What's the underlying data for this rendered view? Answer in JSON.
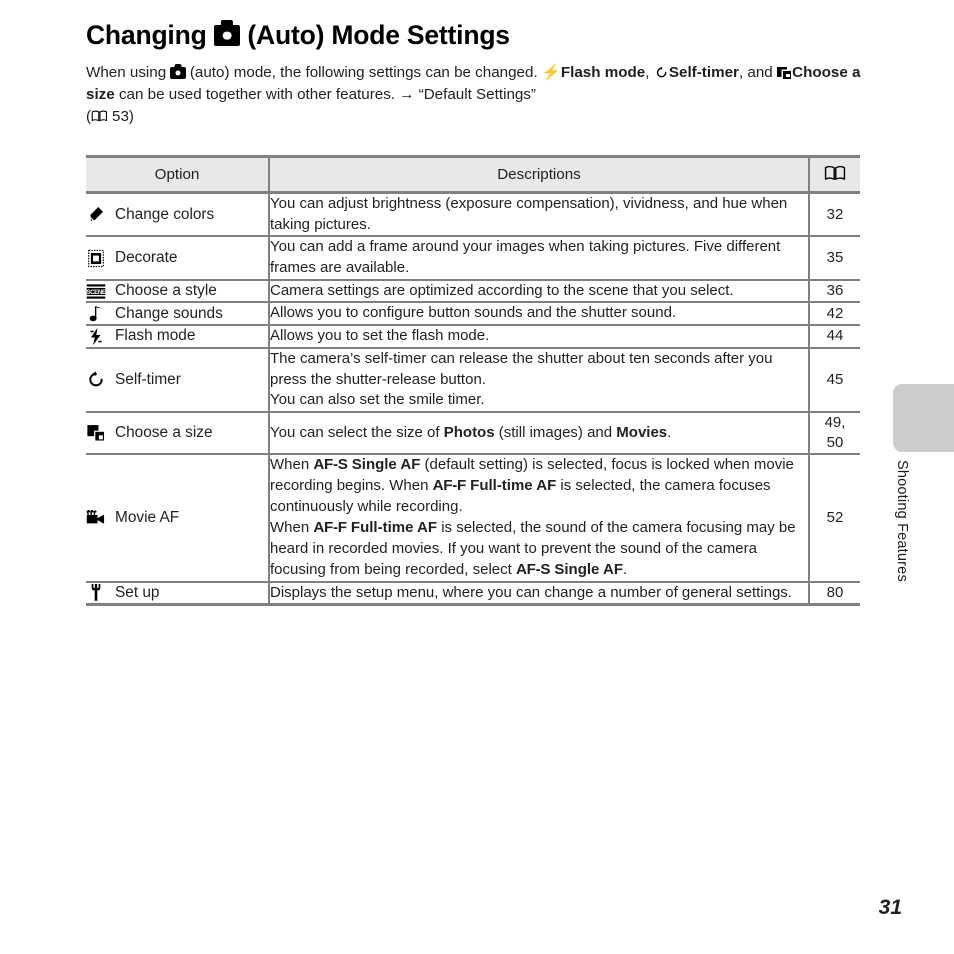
{
  "document": {
    "title_prefix": "Changing ",
    "title_suffix": " (Auto) Mode Settings",
    "title_icon": "camera-auto-icon",
    "page_number": "31",
    "side_tab_label": "Shooting Features"
  },
  "intro": {
    "seg1": "When using ",
    "icon1": "camera-auto-icon",
    "seg2": " (auto) mode, the following settings can be changed. ",
    "icon2": "flash-icon",
    "bold1": "Flash mode",
    "seg3": ", ",
    "icon3": "self-timer-icon",
    "bold2": "Self-timer",
    "seg4": ", and ",
    "icon4": "choose-a-size-icon",
    "bold3": "Choose a size",
    "seg5": " can be used together with other features. ",
    "arrow": "→",
    "seg6": " “Default Settings”",
    "ref_open": "(",
    "ref_icon": "book-icon",
    "ref_page": "53",
    "ref_close": ")"
  },
  "table": {
    "headers": {
      "option": "Option",
      "descriptions": "Descriptions",
      "reference": "book-icon"
    },
    "rows": [
      {
        "icon": "change-colors-icon",
        "option": "Change colors",
        "description_parts": [
          {
            "t": "You can adjust brightness (exposure compensation), vividness, and hue when taking pictures.",
            "b": false
          }
        ],
        "reference": "32"
      },
      {
        "icon": "decorate-icon",
        "option": "Decorate",
        "description_parts": [
          {
            "t": "You can add a frame around your images when taking pictures. Five different frames are available.",
            "b": false
          }
        ],
        "reference": "35"
      },
      {
        "icon": "choose-a-style-icon",
        "option": "Choose a style",
        "description_parts": [
          {
            "t": "Camera settings are optimized according to the scene that you select.",
            "b": false
          }
        ],
        "reference": "36"
      },
      {
        "icon": "change-sounds-icon",
        "option": "Change sounds",
        "description_parts": [
          {
            "t": "Allows you to configure button sounds and the shutter sound.",
            "b": false
          }
        ],
        "reference": "42"
      },
      {
        "icon": "flash-icon",
        "option": "Flash mode",
        "description_parts": [
          {
            "t": "Allows you to set the flash mode.",
            "b": false
          }
        ],
        "reference": "44"
      },
      {
        "icon": "self-timer-icon",
        "option": "Self-timer",
        "description_parts": [
          {
            "t": "The camera’s self-timer can release the shutter about ten seconds after you press the shutter-release button.",
            "b": false
          },
          {
            "t": "\n",
            "b": false
          },
          {
            "t": "You can also set the smile timer.",
            "b": false
          }
        ],
        "reference": "45"
      },
      {
        "icon": "choose-a-size-icon",
        "option": "Choose a size",
        "description_parts": [
          {
            "t": "You can select the size of ",
            "b": false
          },
          {
            "t": "Photos",
            "b": true
          },
          {
            "t": " (still images) and ",
            "b": false
          },
          {
            "t": "Movies",
            "b": true
          },
          {
            "t": ".",
            "b": false
          }
        ],
        "reference": "49,\n50"
      },
      {
        "icon": "movie-af-icon",
        "option": "Movie AF",
        "description_parts": [
          {
            "t": "When ",
            "b": false
          },
          {
            "t": "AF-S Single AF",
            "b": true
          },
          {
            "t": " (default setting) is selected, focus is locked when movie recording begins. When ",
            "b": false
          },
          {
            "t": "AF-F Full-time AF",
            "b": true
          },
          {
            "t": " is selected, the camera focuses continuously while recording.",
            "b": false
          },
          {
            "t": "\n",
            "b": false
          },
          {
            "t": "When ",
            "b": false
          },
          {
            "t": "AF-F Full-time AF",
            "b": true
          },
          {
            "t": " is selected, the sound of the camera focusing may be heard in recorded movies. If you want to prevent the sound of the camera focusing from being recorded, select ",
            "b": false
          },
          {
            "t": "AF-S Single AF",
            "b": true
          },
          {
            "t": ".",
            "b": false
          }
        ],
        "reference": "52"
      },
      {
        "icon": "set-up-icon",
        "option": "Set up",
        "description_parts": [
          {
            "t": "Displays the setup menu, where you can change a number of general settings.",
            "b": false
          }
        ],
        "reference": "80"
      }
    ]
  },
  "colors": {
    "border": "#808080",
    "header_bg": "#e8e8e8",
    "tab_gray": "#cccccc",
    "text": "#231f20"
  }
}
